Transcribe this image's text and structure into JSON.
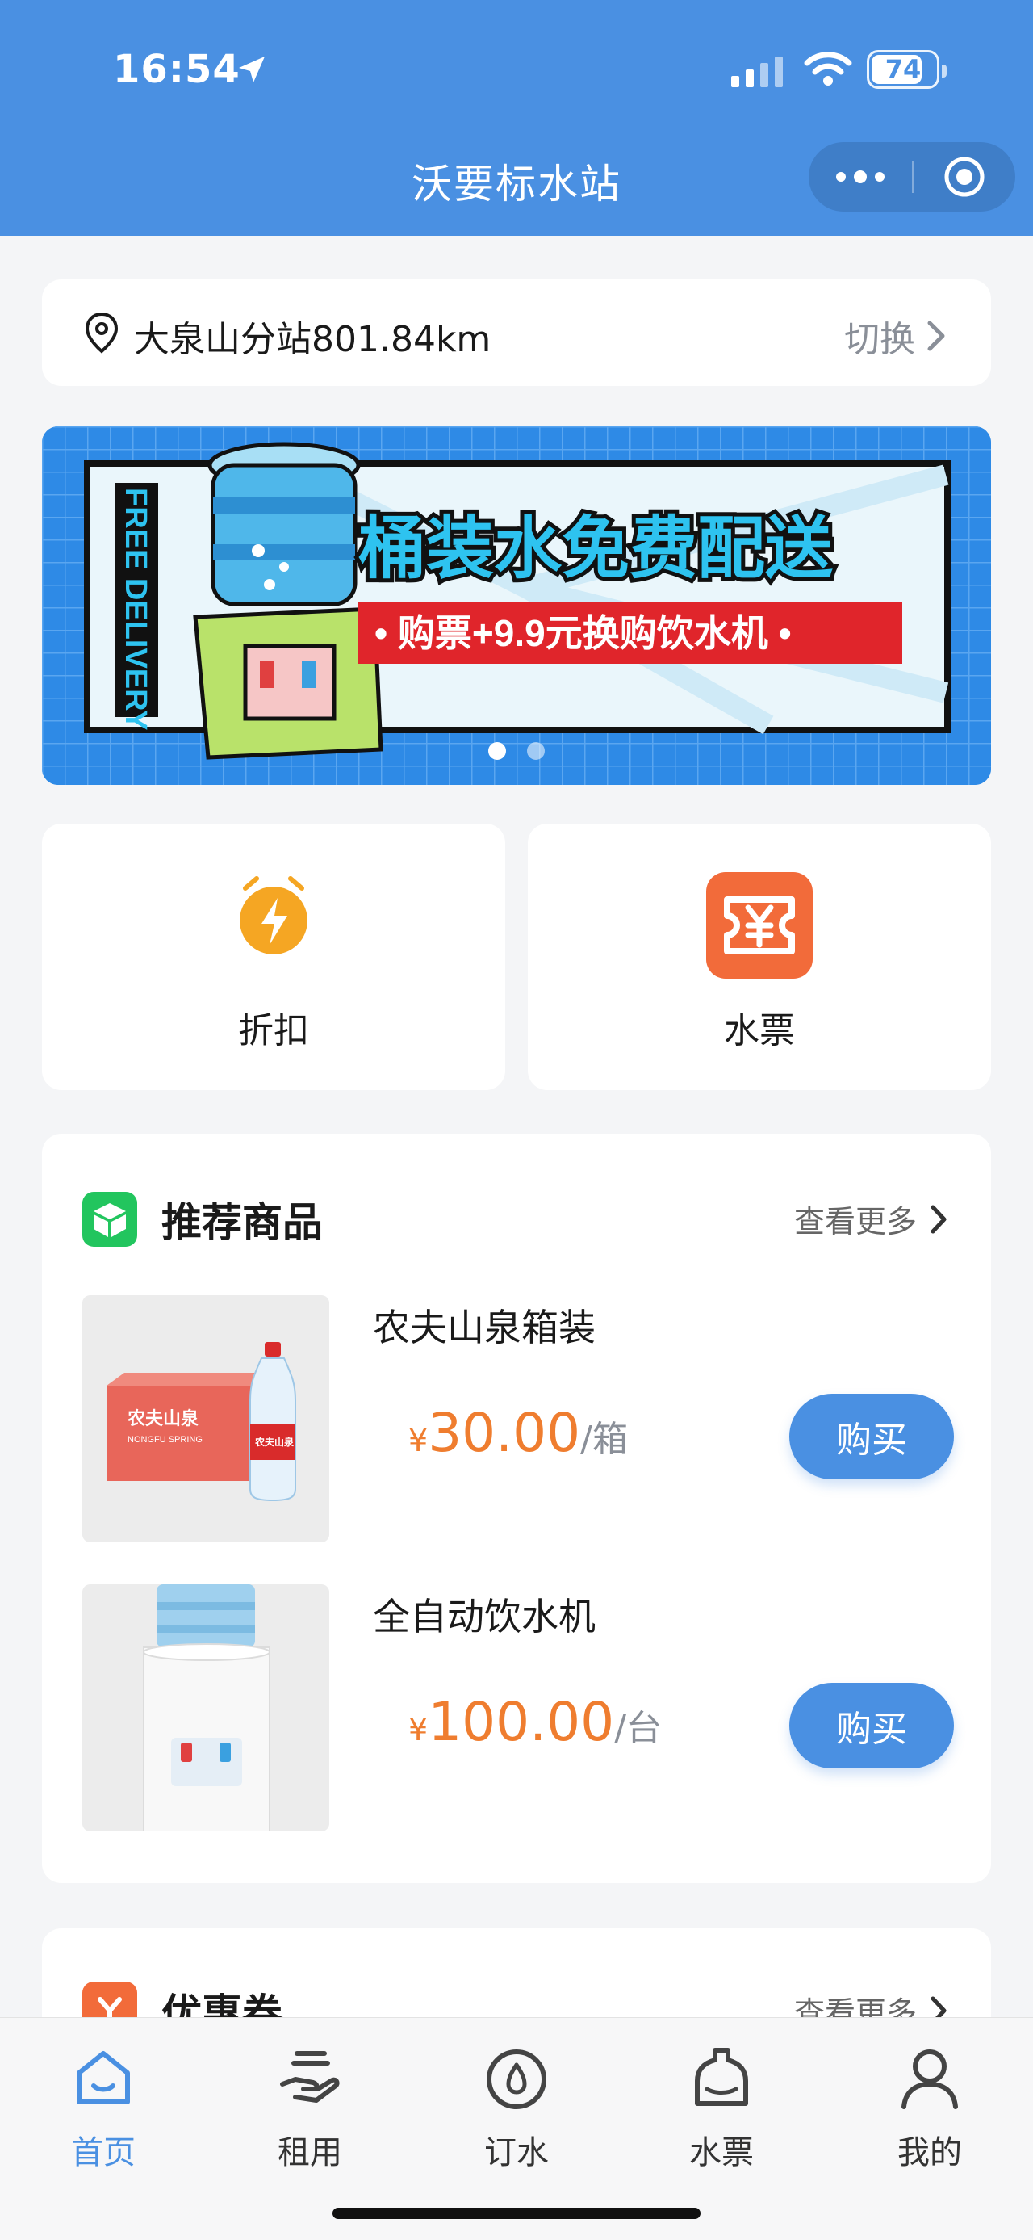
{
  "status": {
    "time": "16:54",
    "battery": "74"
  },
  "nav": {
    "title": "沃要标水站"
  },
  "location": {
    "text": "大泉山分站801.84km",
    "switch_label": "切换"
  },
  "banner": {
    "side_text": "FREE DELIVERY",
    "headline": "桶装水免费配送",
    "subline": "• 购票+9.9元换购饮水机 •",
    "pages": 2,
    "active_page": 1
  },
  "quick_actions": [
    {
      "label": "折扣",
      "icon": "lightning-alarm-icon"
    },
    {
      "label": "水票",
      "icon": "yen-ticket-icon"
    }
  ],
  "recommended": {
    "title": "推荐商品",
    "more_label": "查看更多",
    "items": [
      {
        "name": "农夫山泉箱装",
        "currency": "¥",
        "price": "30.00",
        "unit": "/箱",
        "buy_label": "购买",
        "box_brand": "农夫山泉",
        "box_sub": "NONGFU SPRING"
      },
      {
        "name": "全自动饮水机",
        "currency": "¥",
        "price": "100.00",
        "unit": "/台",
        "buy_label": "购买"
      }
    ]
  },
  "coupons": {
    "title": "优惠券",
    "more_label": "查看更多"
  },
  "tabbar": [
    {
      "label": "首页",
      "icon": "home-icon",
      "active": true
    },
    {
      "label": "租用",
      "icon": "hand-rent-icon",
      "active": false
    },
    {
      "label": "订水",
      "icon": "water-drop-icon",
      "active": false
    },
    {
      "label": "水票",
      "icon": "water-bottle-icon",
      "active": false
    },
    {
      "label": "我的",
      "icon": "user-icon",
      "active": false
    }
  ],
  "colors": {
    "primary": "#4a90e2",
    "price": "#ef7d2f",
    "banner_red": "#e0252b"
  }
}
